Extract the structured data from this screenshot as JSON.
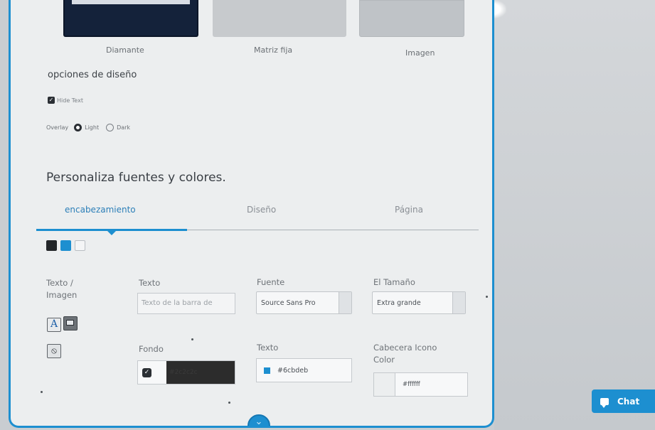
{
  "layouts": {
    "diamond_label": "Diamante",
    "matrix_label": "Matriz fija",
    "image_label": "Imagen"
  },
  "design_options": {
    "title": "opciones de diseño",
    "hide_text_label": "Hide Text",
    "hide_text_checked": true,
    "overlay_label": "Overlay",
    "overlay_options": [
      "Light",
      "Dark"
    ],
    "overlay_selected": "Light"
  },
  "customize": {
    "title": "Personaliza fuentes y colores.",
    "tabs": [
      "encabezamiento",
      "Diseño",
      "Página"
    ],
    "active_tab": "encabezamiento",
    "swatch_colors": [
      "#232629",
      "#1d8fd0",
      "#f4f5f6"
    ]
  },
  "fields": {
    "text_image_label_line1": "Texto /",
    "text_image_label_line2": "Imagen",
    "text_label": "Texto",
    "text_placeholder": "Texto de la barra de",
    "font_label": "Fuente",
    "font_value": "Source Sans Pro",
    "size_label": "El Tamaño",
    "size_value": "Extra grande",
    "background_label": "Fondo",
    "background_value": "#2c2c2c",
    "text_color_label": "Texto",
    "text_color_value": "#6cbdeb",
    "header_icon_label_line1": "Cabecera Icono",
    "header_icon_label_line2": "Color",
    "header_icon_value": "#ffffff"
  },
  "icons": {
    "text_mode": "text-A-icon",
    "image_mode": "image-icon",
    "none_mode": "prohibited-icon"
  },
  "chat": {
    "label": "Chat"
  },
  "colors": {
    "accent": "#1d8fd0"
  }
}
